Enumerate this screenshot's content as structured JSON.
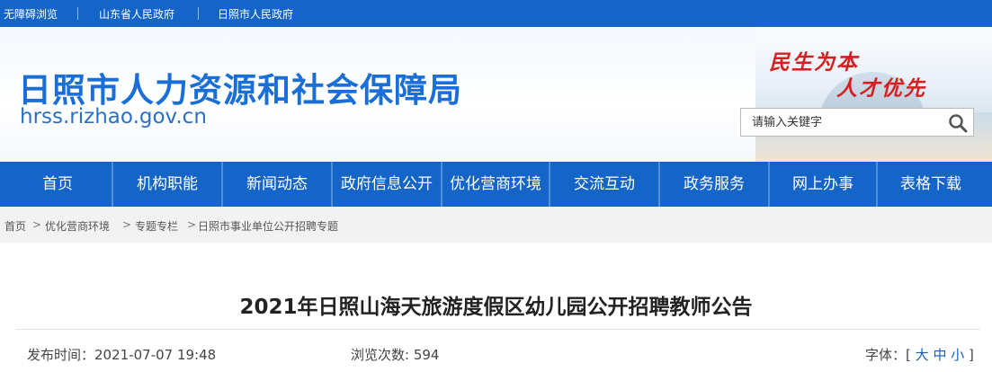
{
  "topbar": {
    "accessibility": "无障碍浏览",
    "link1": "山东省人民政府",
    "link2": "日照市人民政府"
  },
  "header": {
    "title": "日照市人力资源和社会保障局",
    "domain": "hrss.rizhao.gov.cn",
    "slogan_line1": "民生为本",
    "slogan_line2": "人才优先"
  },
  "search": {
    "placeholder": "请输入关键字",
    "icon": "search-icon"
  },
  "nav": {
    "items": [
      "首页",
      "机构职能",
      "新闻动态",
      "政府信息公开",
      "优化营商环境",
      "交流互动",
      "政务服务",
      "网上办事",
      "表格下载"
    ]
  },
  "breadcrumb": {
    "items": [
      "首页",
      "优化营商环境",
      "专题专栏",
      "日照市事业单位公开招聘专题"
    ],
    "separator": ">"
  },
  "article": {
    "title": "2021年日照山海天旅游度假区幼儿园公开招聘教师公告",
    "publish_label": "发布时间：",
    "publish_time": "2021-07-07 19:48",
    "views_label": "浏览次数: ",
    "views": "594",
    "font_label": "字体：",
    "font_open": "[",
    "font_large": "大",
    "font_medium": "中",
    "font_small": "小",
    "font_close": "]"
  },
  "colors": {
    "primary": "#1565c8",
    "title_blue": "#1a6ed8",
    "slogan_red": "#d42020",
    "crumb_bg": "#f2f2f2"
  }
}
